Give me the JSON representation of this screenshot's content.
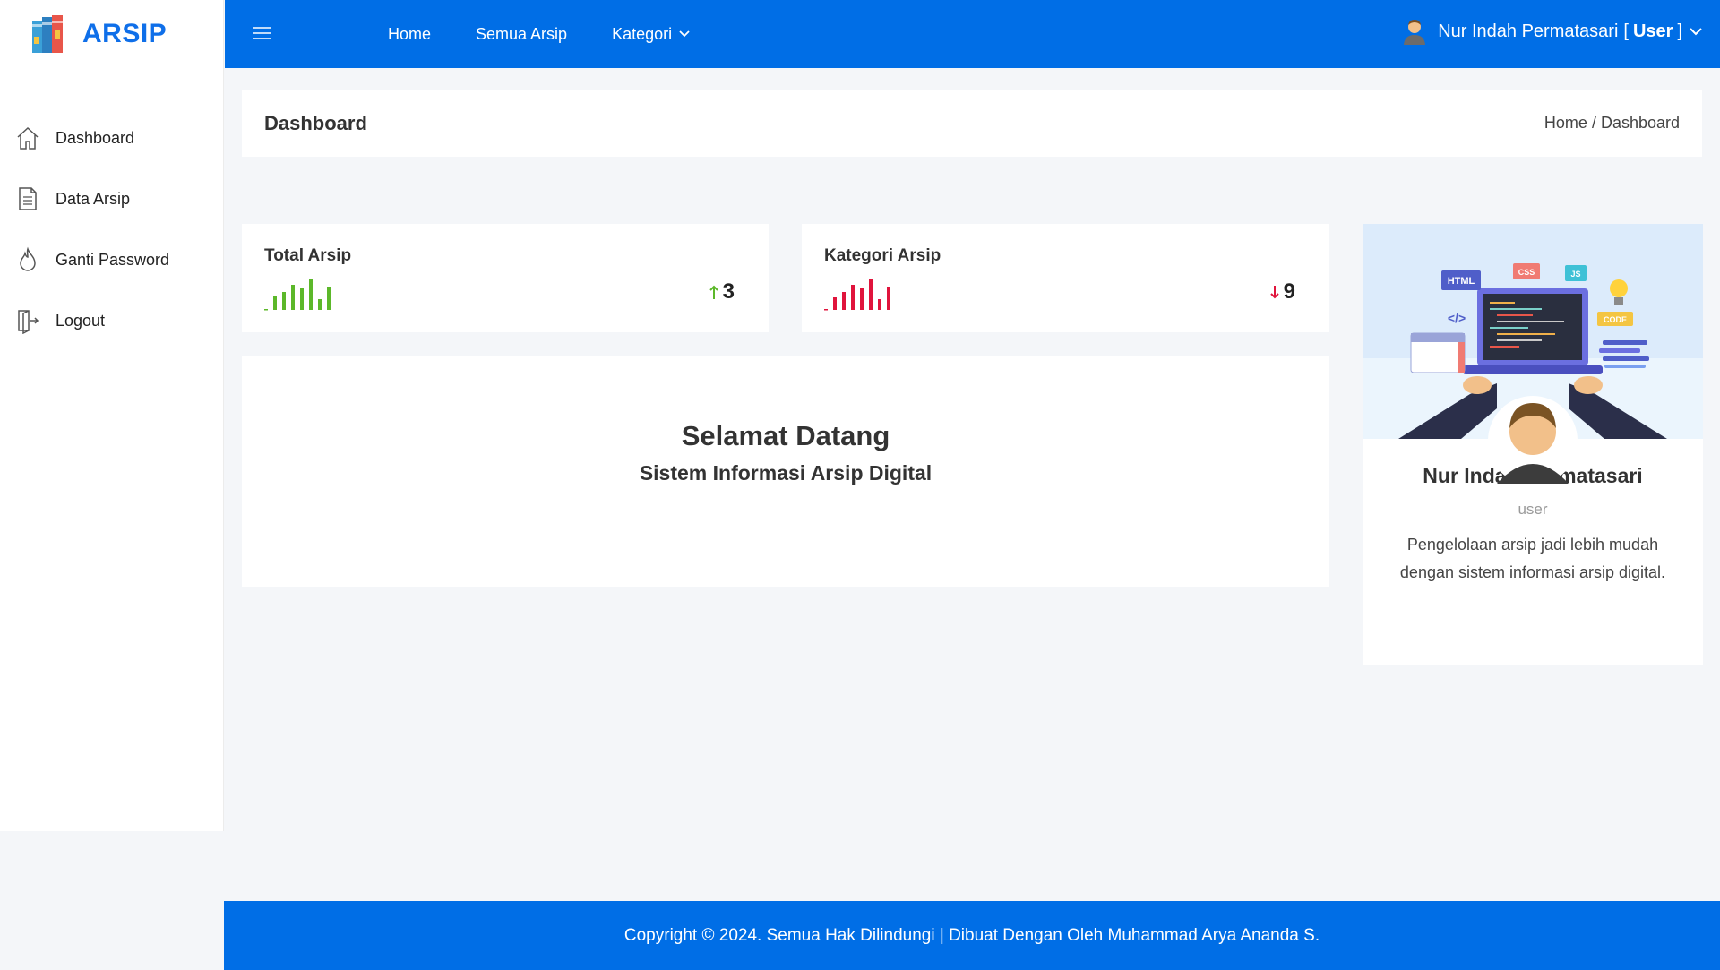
{
  "brand": {
    "name": "ARSIP",
    "logo_icon": "books-icon"
  },
  "sidebar": {
    "items": [
      {
        "label": "Dashboard",
        "icon": "home-icon"
      },
      {
        "label": "Data Arsip",
        "icon": "document-icon"
      },
      {
        "label": "Ganti Password",
        "icon": "flame-icon"
      },
      {
        "label": "Logout",
        "icon": "logout-icon"
      }
    ]
  },
  "topbar": {
    "menu_icon": "hamburger-icon",
    "nav": [
      {
        "label": "Home"
      },
      {
        "label": "Semua Arsip"
      },
      {
        "label": "Kategori",
        "icon": "chevron-down-icon"
      }
    ],
    "user": {
      "name": "Nur Indah Permatasari",
      "role_prefix": "[",
      "role": "User",
      "role_suffix": "]"
    }
  },
  "page": {
    "title": "Dashboard",
    "breadcrumb": "Home / Dashboard"
  },
  "stats": [
    {
      "title": "Total Arsip",
      "value": "3",
      "trend": "up",
      "color": "#5cb82a"
    },
    {
      "title": "Kategori Arsip",
      "value": "9",
      "trend": "down",
      "color": "#e0143c"
    }
  ],
  "welcome": {
    "title": "Selamat Datang",
    "subtitle": "Sistem Informasi Arsip Digital"
  },
  "profile": {
    "name": "Nur Indah Permatasari",
    "role": "user",
    "description": "Pengelolaan arsip jadi lebih mudah dengan sistem informasi arsip digital.",
    "badges": [
      "HTML",
      "CSS",
      "JS",
      "CODE",
      "</>"
    ]
  },
  "footer": {
    "text": "Copyright © 2024. Semua Hak Dilindungi | Dibuat Dengan Oleh Muhammad Arya Ananda S."
  },
  "colors": {
    "primary": "#006ee6",
    "up": "#5cb82a",
    "down": "#e0143c"
  }
}
